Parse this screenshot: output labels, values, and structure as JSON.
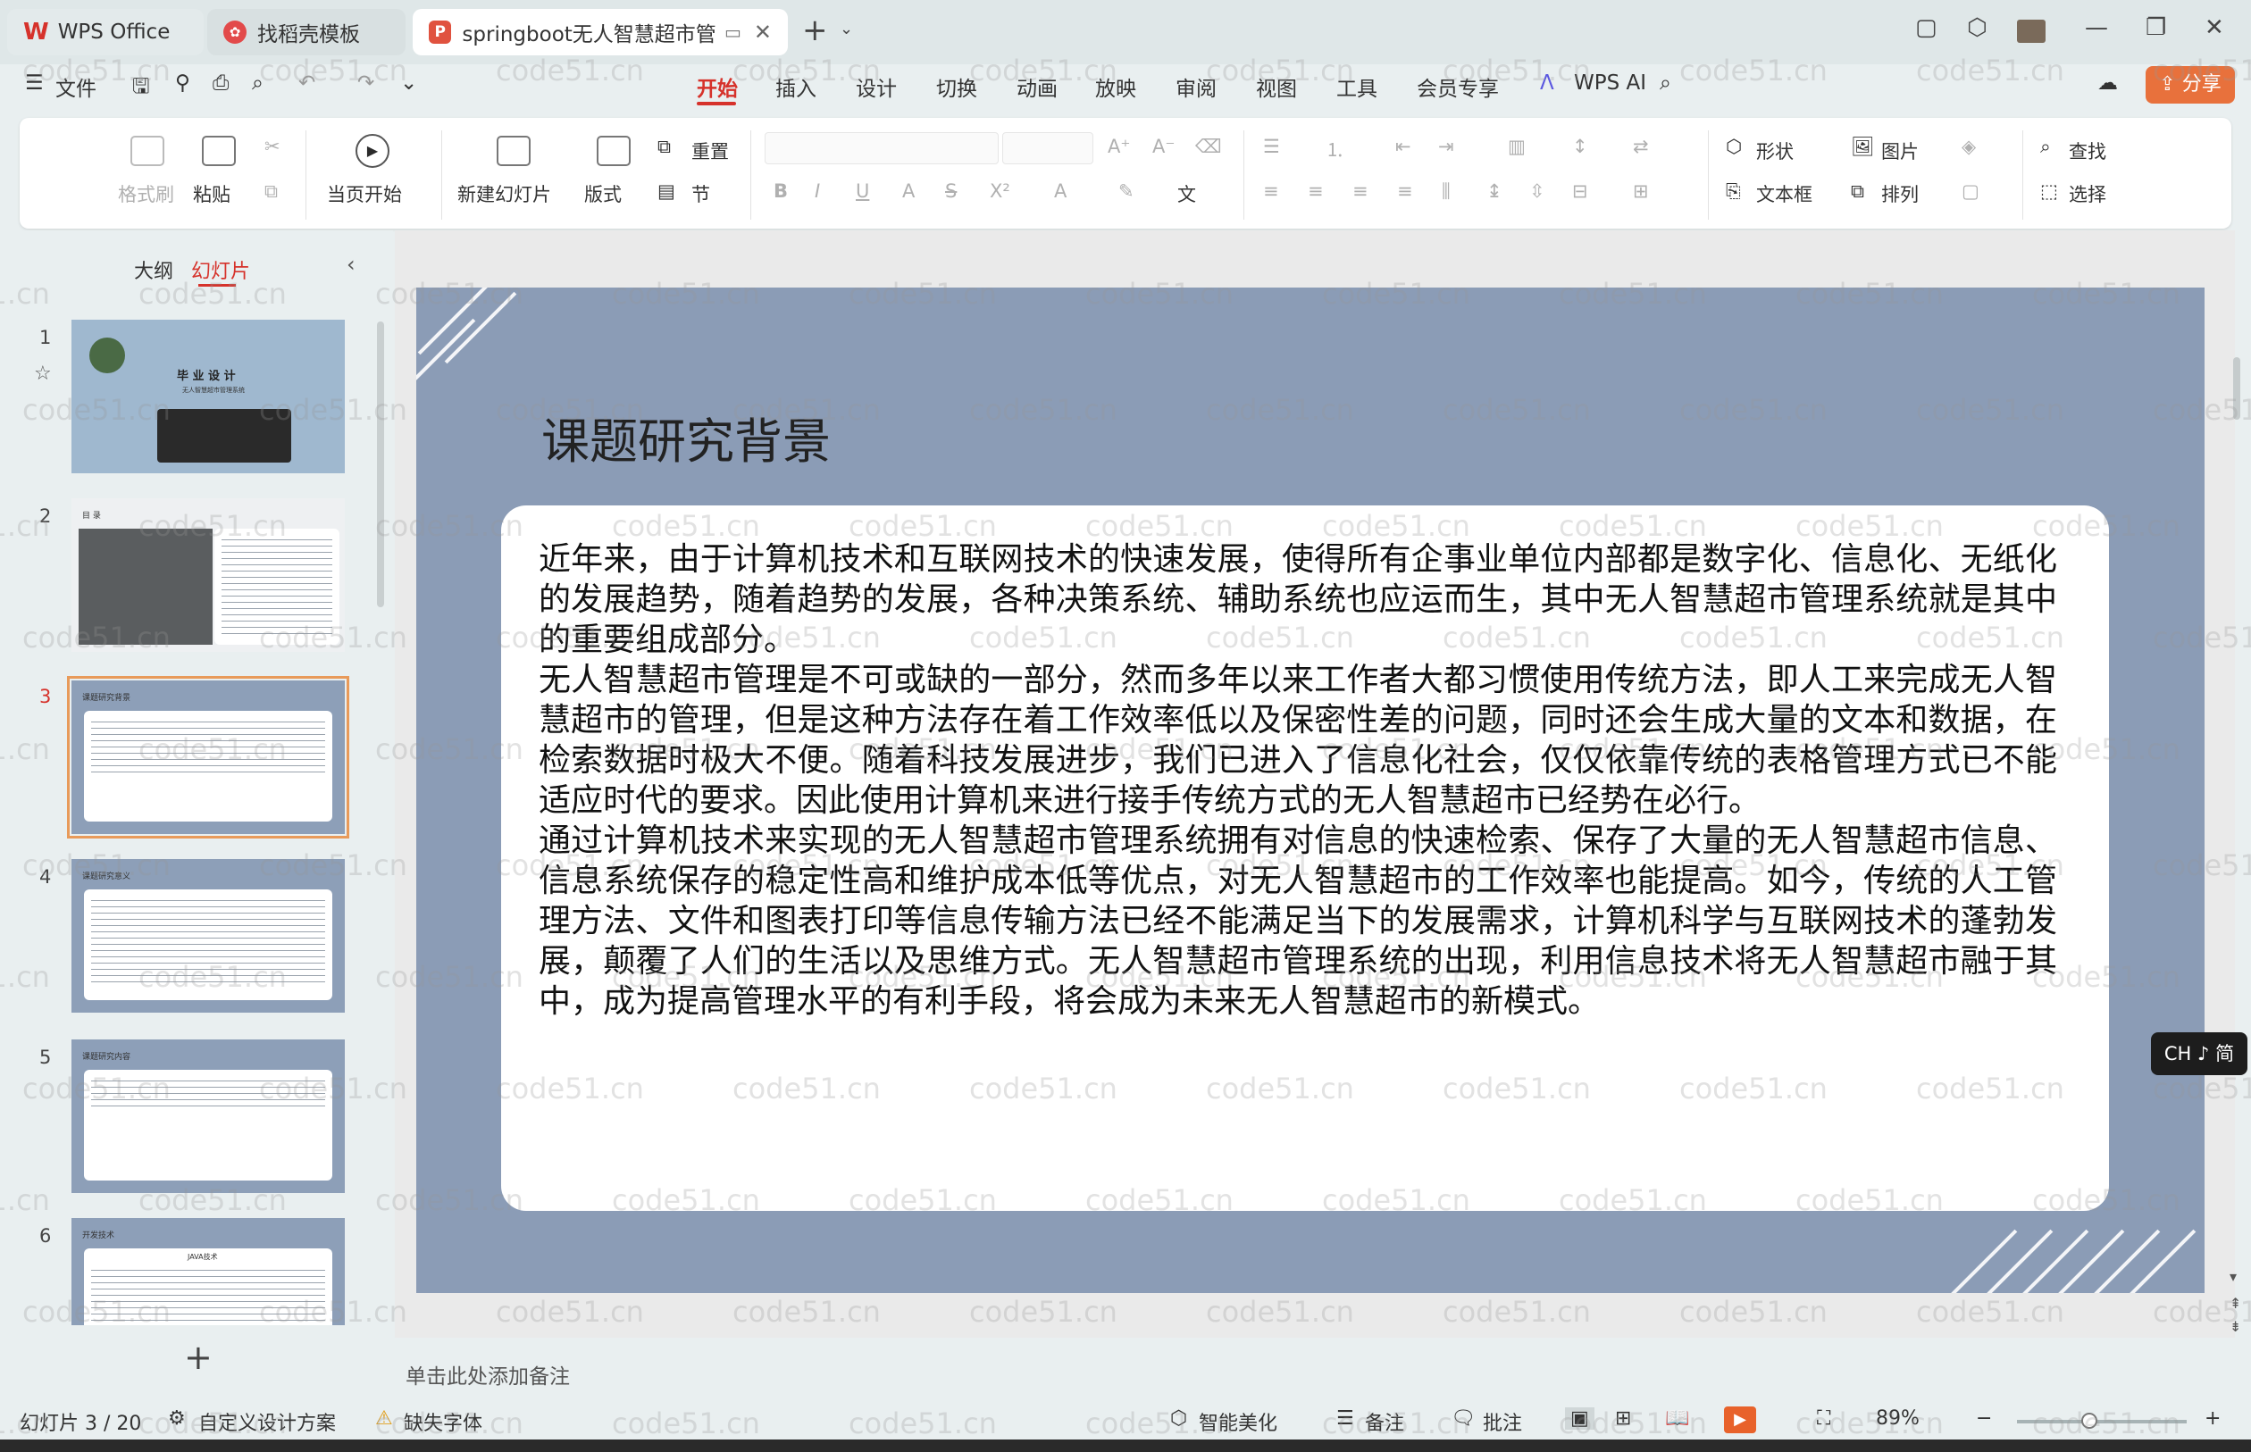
{
  "tabs": [
    {
      "label": "WPS Office"
    },
    {
      "label": "找稻壳模板"
    },
    {
      "label": "springboot无人智慧超市管理"
    }
  ],
  "menu": {
    "file": "文件",
    "items": [
      "开始",
      "插入",
      "设计",
      "切换",
      "动画",
      "放映",
      "审阅",
      "视图",
      "工具",
      "会员专享",
      "WPS AI"
    ],
    "share": "分享"
  },
  "ribbon": {
    "format_painter": "格式刷",
    "paste": "粘贴",
    "from_current": "当页开始",
    "new_slide": "新建幻灯片",
    "layout": "版式",
    "reset": "重置",
    "section": "节",
    "shape": "形状",
    "picture": "图片",
    "textbox": "文本框",
    "arrange": "排列",
    "find": "查找",
    "select": "选择"
  },
  "sidebar": {
    "outline_tab": "大纲",
    "slides_tab": "幻灯片",
    "slides": [
      {
        "number": "1",
        "title": "毕 业 设 计",
        "subtitle": "无人智慧超市管理系统"
      },
      {
        "number": "2",
        "title": "目 录"
      },
      {
        "number": "3",
        "title": "课题研究背景"
      },
      {
        "number": "4",
        "title": "课题研究意义"
      },
      {
        "number": "5",
        "title": "课题研究内容"
      },
      {
        "number": "6",
        "title": "开发技术",
        "subtitle": "JAVA技术"
      }
    ]
  },
  "slide": {
    "title": "课题研究背景",
    "paragraphs": [
      "近年来，由于计算机技术和互联网技术的快速发展，使得所有企事业单位内部都是数字化、信息化、无纸化的发展趋势，随着趋势的发展，各种决策系统、辅助系统也应运而生，其中无人智慧超市管理系统就是其中的重要组成部分。",
      "无人智慧超市管理是不可或缺的一部分，然而多年以来工作者大都习惯使用传统方法，即人工来完成无人智慧超市的管理，但是这种方法存在着工作效率低以及保密性差的问题，同时还会生成大量的文本和数据，在检索数据时极大不便。随着科技发展进步，我们已进入了信息化社会，仅仅依靠传统的表格管理方式已不能适应时代的要求。因此使用计算机来进行接手传统方式的无人智慧超市已经势在必行。",
      "通过计算机技术来实现的无人智慧超市管理系统拥有对信息的快速检索、保存了大量的无人智慧超市信息、信息系统保存的稳定性高和维护成本低等优点，对无人智慧超市的工作效率也能提高。如今，传统的人工管理方法、文件和图表打印等信息传输方法已经不能满足当下的发展需求，计算机科学与互联网技术的蓬勃发展，颠覆了人们的生活以及思维方式。无人智慧超市管理系统的出现，利用信息技术将无人智慧超市融于其中，成为提高管理水平的有利手段，将会成为未来无人智慧超市的新模式。"
    ]
  },
  "notes_placeholder": "单击此处添加备注",
  "status": {
    "slide_counter": "幻灯片 3 / 20",
    "custom_design": "自定义设计方案",
    "missing_fonts": "缺失字体",
    "beautify": "智能美化",
    "notes": "备注",
    "comments": "批注",
    "zoom": "89%"
  },
  "ime": "CH ♪ 简",
  "watermark": "code51.cn",
  "colors": {
    "accent": "#d6322b",
    "slide_bg": "#8b9cb6",
    "share": "#e8713c"
  }
}
